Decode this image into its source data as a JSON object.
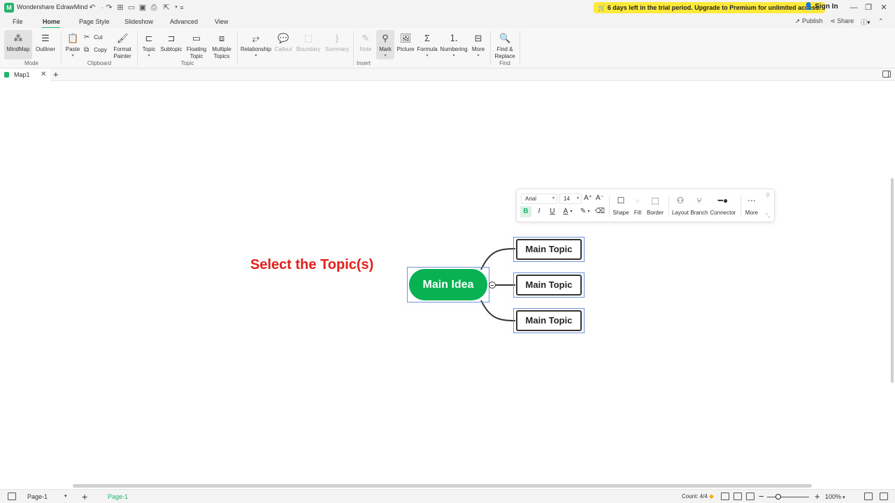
{
  "app": {
    "title": "Wondershare EdrawMind",
    "logo_letter": "M",
    "trial_notice": "6 days left in the trial period. Upgrade to Premium for unlimited access.",
    "sign_in": "Sign In",
    "accent_color": "#1fb46a"
  },
  "quick_access": [
    "undo-icon",
    "redo-icon",
    "new-icon",
    "open-icon",
    "save-icon",
    "print-icon",
    "export-icon",
    "more-icon"
  ],
  "menu": {
    "tabs": [
      "File",
      "Home",
      "Page Style",
      "Slideshow",
      "Advanced",
      "View"
    ],
    "active": "Home",
    "publish": "Publish",
    "share": "Share"
  },
  "ribbon": {
    "mode": {
      "label": "Mode",
      "mindmap": "MindMap",
      "outliner": "Outliner"
    },
    "clipboard": {
      "label": "Clipboard",
      "paste": "Paste",
      "cut": "Cut",
      "copy": "Copy",
      "format_painter_1": "Format",
      "format_painter_2": "Painter"
    },
    "topic": {
      "label": "Topic",
      "topic": "Topic",
      "subtopic": "Subtopic",
      "floating_1": "Floating",
      "floating_2": "Topic",
      "multiple_1": "Multiple",
      "multiple_2": "Topics"
    },
    "insert": {
      "label": "Insert",
      "relationship": "Relationship",
      "callout": "Callout",
      "boundary": "Boundary",
      "summary": "Summary",
      "note": "Note",
      "mark": "Mark",
      "picture": "Picture",
      "formula": "Formula",
      "numbering": "Numbering",
      "more": "More"
    },
    "find": {
      "label": "Find",
      "find_replace_1": "Find &",
      "find_replace_2": "Replace"
    }
  },
  "document_tab": {
    "name": "Map1"
  },
  "canvas": {
    "instruction": "Select the Topic(s)",
    "main_idea": "Main Idea",
    "topics": [
      "Main Topic",
      "Main Topic",
      "Main Topic"
    ],
    "main_idea_color": "#08b152",
    "instruction_color": "#e0201b",
    "selection_color": "#6f93dc"
  },
  "floating_toolbar": {
    "font": "Arial",
    "font_size": "14",
    "increase_font": "A⁺",
    "decrease_font": "A⁻",
    "bold": "B",
    "italic": "I",
    "underline": "U",
    "font_color": "A",
    "shape": "Shape",
    "fill": "Fill",
    "border": "Border",
    "layout": "Layout",
    "branch": "Branch",
    "connector": "Connector",
    "more": "More"
  },
  "status": {
    "page_select": "Page-1",
    "page_tab": "Page-1",
    "count": "Count: 4/4",
    "zoom": "100%"
  }
}
